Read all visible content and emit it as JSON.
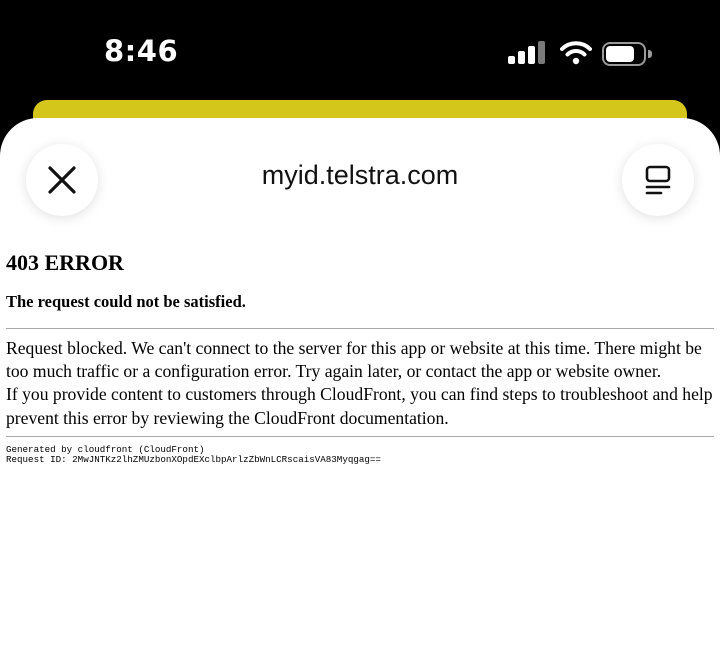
{
  "status_bar": {
    "time": "8:46",
    "icons": [
      "signal-icon",
      "wifi-icon",
      "battery-icon"
    ]
  },
  "colors": {
    "background": "#000000",
    "sheet": "#ffffff",
    "underlying_sheet": "#d4c61a"
  },
  "browser_sheet": {
    "title": "myid.telstra.com",
    "close_icon": "close-icon",
    "menu_icon": "menu-icon"
  },
  "error_page": {
    "title": "403 ERROR",
    "subtitle": "The request could not be satisfied.",
    "message_line1": "Request blocked. We can't connect to the server for this app or website at this time. There might be too much traffic or a configuration error. Try again later, or contact the app or website owner.",
    "message_line2": "If you provide content to customers through CloudFront, you can find steps to troubleshoot and help prevent this error by reviewing the CloudFront documentation.",
    "generated_by": "Generated by cloudfront (CloudFront)",
    "request_id": "Request ID: 2MwJNTKz2lhZMUzbonXOpdEXclbpArlzZbWnLCRscaisVA83Myqgag=="
  }
}
